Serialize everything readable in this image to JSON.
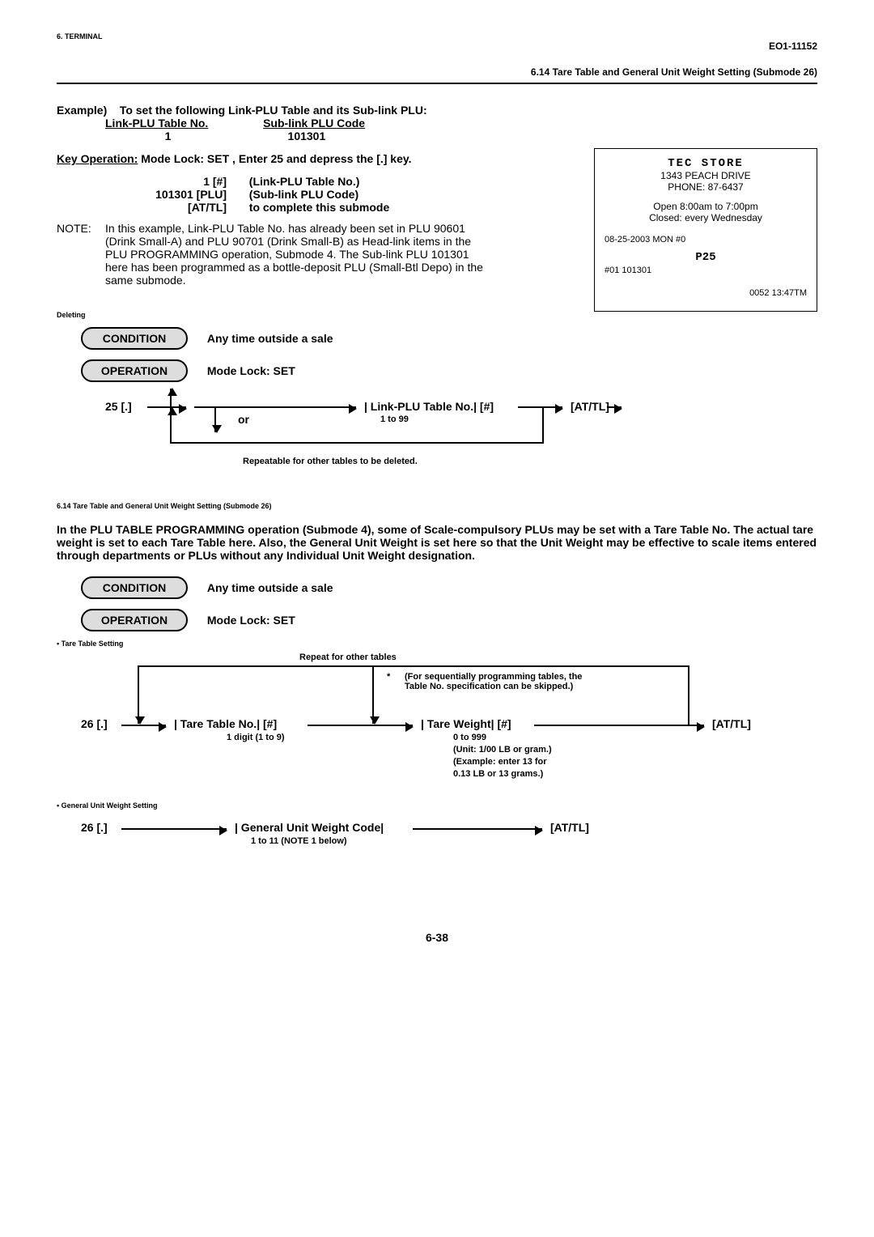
{
  "header": {
    "doc_code": "EO1-11152",
    "section_title": "6.14 Tare Table and General Unit Weight Setting (Submode 26)"
  },
  "example": {
    "label": "Example)",
    "intro": "To set the following Link-PLU Table and its Sub-link PLU:",
    "col1_hdr": "Link-PLU Table No.",
    "col2_hdr": "Sub-link PLU Code",
    "col1_val": "1",
    "col2_val": "101301",
    "keyop_label": "Key Operation:",
    "keyop_text": " Mode Lock: SET    , Enter 25 and depress the [.]    key.",
    "line1_left": "1 [#]",
    "line1_right": "(Link-PLU Table No.)",
    "line2_left": "101301 [PLU]",
    "line2_right": "(Sub-link PLU Code)",
    "line3_left": "[AT/TL]",
    "line3_right": "to complete this submode",
    "note_label": "NOTE:",
    "note_text": "In this example, Link-PLU Table No. has already been set in PLU 90601 (Drink Small-A) and PLU 90701 (Drink Small-B) as Head-link items in the PLU PROGRAMMING operation, Submode 4.  The Sub-link PLU 101301 here has been programmed as a bottle-deposit PLU (Small-Btl Depo) in the same submode."
  },
  "receipt": {
    "store": "TEC STORE",
    "addr": "1343 PEACH DRIVE",
    "phone": "PHONE: 87-6437",
    "hours": "Open  8:00am to 7:00pm",
    "closed": "Closed: every Wednesday",
    "dateline": "08-25-2003 MON  #0",
    "mode": "P25",
    "item": "#01 101301",
    "footer": "0052 13:47TM"
  },
  "deleting": {
    "title": "Deleting",
    "condition_label": "CONDITION",
    "condition_text": "Any time outside a sale",
    "operation_label": "OPERATION",
    "operation_text": "Mode Lock: SET",
    "flow_prefix": "25 [.]",
    "flow_or": "or",
    "flow_item": "| Link-PLU Table No.| [#]",
    "flow_range": "1 to 99",
    "flow_end": "[AT/TL]",
    "flow_note": "Repeatable for other tables to be deleted."
  },
  "sec614": {
    "heading": "6.14  Tare Table and General Unit Weight Setting (Submode 26)",
    "para": "In the PLU TABLE PROGRAMMING operation (Submode 4), some of Scale-compulsory PLUs may be set with a Tare Table No.  The actual tare weight is set to each Tare Table here.  Also, the General Unit Weight is set here so that the Unit Weight may be effective to scale items entered through departments or PLUs without any Individual Unit Weight designation.",
    "condition_label": "CONDITION",
    "condition_text": "Any time outside a sale",
    "operation_label": "OPERATION",
    "operation_text": "Mode Lock: SET",
    "tare_label": "• Tare Table Setting",
    "repeat_note": "Repeat for other tables",
    "skip_note_star": "*",
    "skip_note": "(For sequentially programming tables, the Table No. specification can be skipped.)",
    "flow_prefix": "26 [.]",
    "tare_no": "| Tare Table No.| [#]",
    "tare_no_detail": "1 digit (1 to 9)",
    "tare_wt": "| Tare Weight| [#]",
    "tare_wt_detail1": "0 to 999",
    "tare_wt_detail2": "(Unit: 1/00 LB or gram.)",
    "tare_wt_detail3": "(Example: enter 13 for",
    "tare_wt_detail4": "0.13 LB or 13 grams.)",
    "flow_end": "[AT/TL]",
    "guw_label": "• General Unit Weight Setting",
    "guw_prefix": "26 [.]",
    "guw_item": "| General Unit Weight Code|",
    "guw_detail": "1 to 11 (NOTE 1 below)",
    "guw_end": "[AT/TL]"
  },
  "footer": {
    "page": "6-38"
  }
}
